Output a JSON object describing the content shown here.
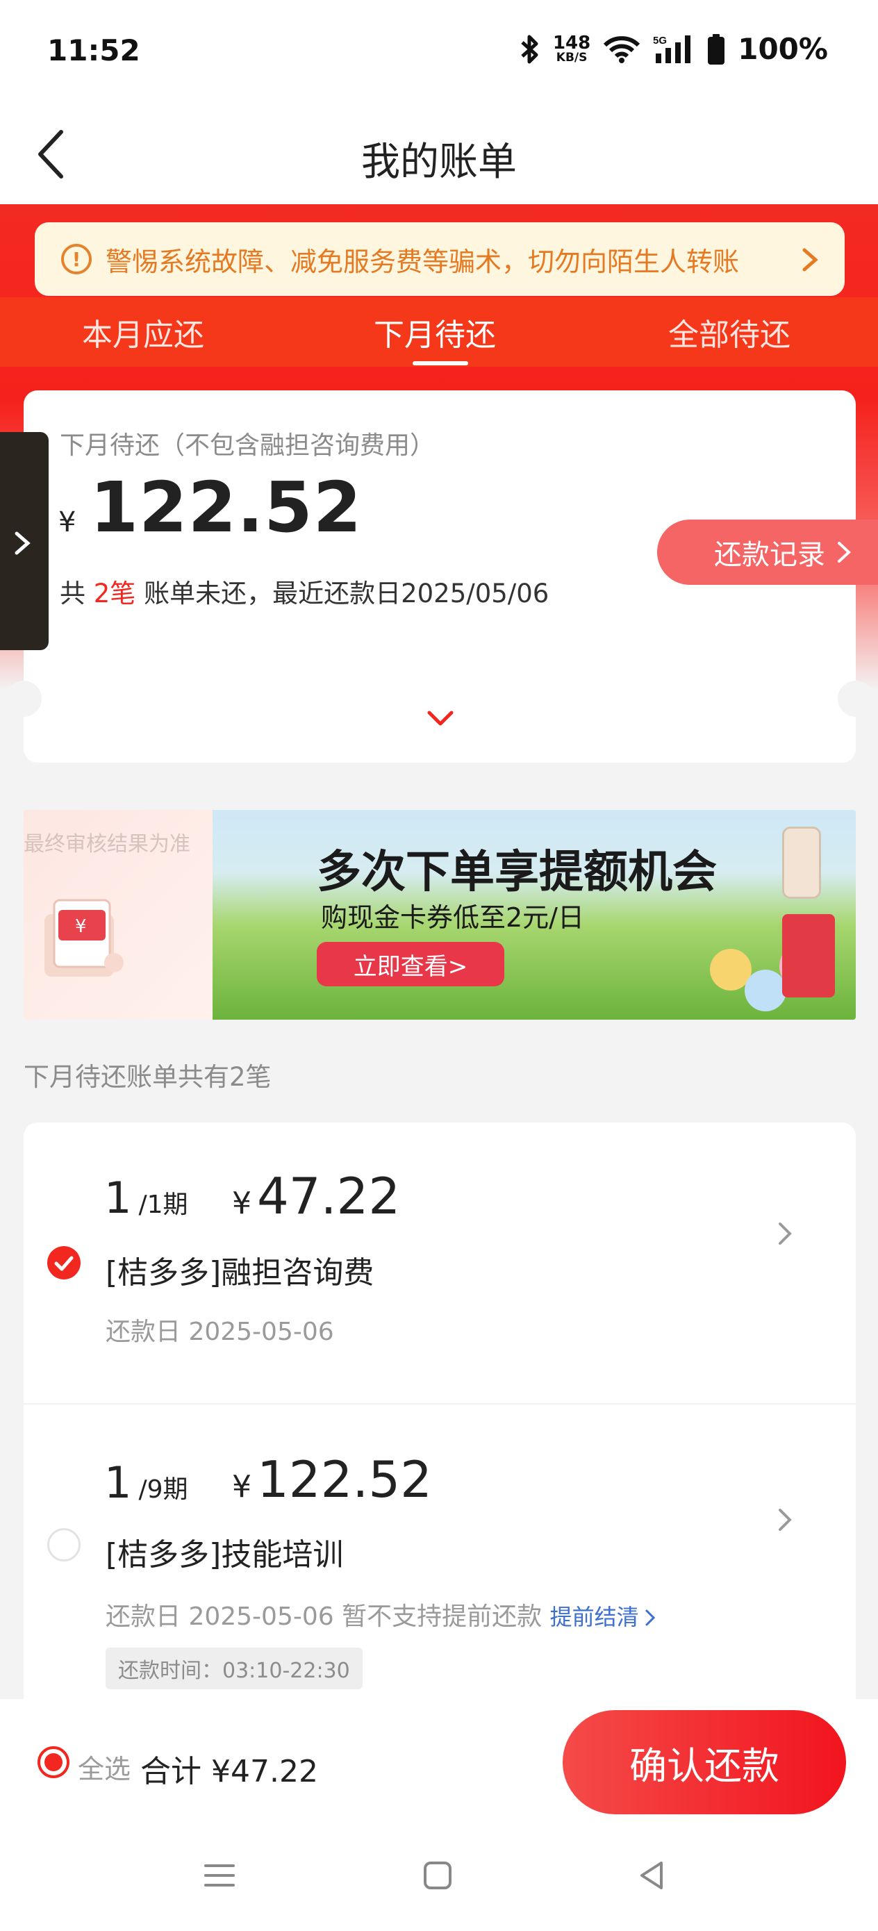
{
  "status_bar": {
    "time": "11:52",
    "net_speed": "148",
    "net_speed_unit": "KB/S",
    "network": "5G",
    "battery": "100%",
    "icons": [
      "bluetooth-icon",
      "wifi-icon",
      "signal-icon",
      "battery-icon"
    ]
  },
  "header": {
    "title": "我的账单",
    "back_icon": "chevron-left-icon"
  },
  "notice": {
    "text": "警惕系统故障、减免服务费等骗术，切勿向陌生人转账",
    "icon": "warning-icon"
  },
  "tabs": [
    {
      "label": "本月应还",
      "active": false
    },
    {
      "label": "下月待还",
      "active": true
    },
    {
      "label": "全部待还",
      "active": false
    }
  ],
  "summary": {
    "subtitle": "下月待还（不包含融担咨询费用）",
    "currency": "¥",
    "amount": "122.52",
    "info_prefix": "共 ",
    "info_count": "2笔",
    "info_suffix": " 账单未还，最近还款日2025/05/06",
    "record_button": "还款记录"
  },
  "banner": {
    "hint": "最终审核结果为准",
    "title": "多次下单享提额机会",
    "subtitle": "购现金卡券低至2元/日",
    "button": "立即查看>"
  },
  "list_caption": "下月待还账单共有2笔",
  "bills": [
    {
      "period_current": "1",
      "period_total": "/1期",
      "currency": "¥",
      "amount": "47.22",
      "name": "[桔多多]融担咨询费",
      "date": "还款日 2025-05-06",
      "checked": true
    },
    {
      "period_current": "1",
      "period_total": "/9期",
      "currency": "¥",
      "amount": "122.52",
      "name": "[桔多多]技能培训",
      "date": "还款日 2025-05-06 暂不支持提前还款",
      "early_link": "提前结清",
      "time_window": "还款时间：03:10-22:30",
      "checked": false
    }
  ],
  "bottom": {
    "select_all": "全选",
    "total": "合计 ¥47.22",
    "confirm": "确认还款"
  },
  "colors": {
    "accent": "#f2271f",
    "notice_text": "#e57a22",
    "link": "#3d6fd1"
  }
}
